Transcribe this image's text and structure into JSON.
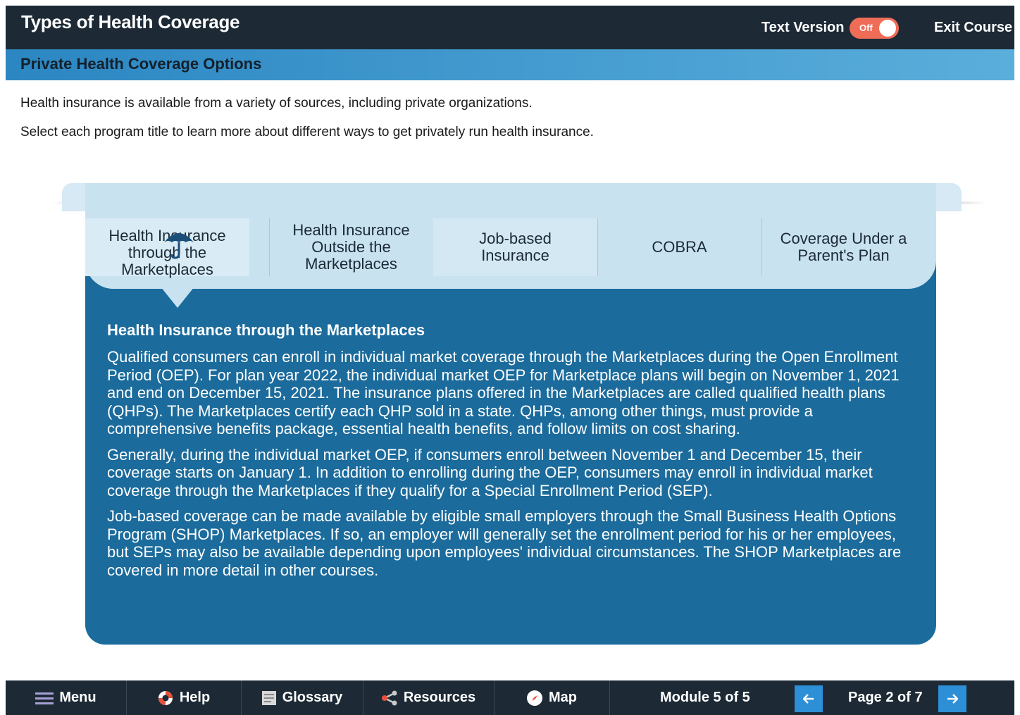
{
  "header": {
    "course_title": "Types of Health Coverage",
    "text_version_label": "Text Version",
    "toggle_state": "Off",
    "exit_label": "Exit Course"
  },
  "section": {
    "title": "Private Health Coverage Options"
  },
  "intro": {
    "line1": "Health insurance is available from a variety of sources, including private organizations.",
    "line2": "Select each program title to learn more about different ways to get privately run health insurance."
  },
  "tabs": [
    {
      "label": "Health Insurance through the Marketplaces",
      "active": true,
      "icon": "umbrella-icon"
    },
    {
      "label": "Health Insurance Outside the Marketplaces",
      "active": false
    },
    {
      "label": "Job-based Insurance",
      "active": false
    },
    {
      "label": "COBRA",
      "active": false
    },
    {
      "label": "Coverage Under a Parent's Plan",
      "active": false
    }
  ],
  "panel": {
    "heading": "Health Insurance through the Marketplaces",
    "paragraphs": [
      "Qualified consumers can enroll in individual market coverage through the Marketplaces during the Open Enrollment Period (OEP). For plan year 2022, the individual market OEP for Marketplace plans will begin on November 1, 2021 and end on December 15, 2021. The insurance plans offered in the Marketplaces are called qualified health plans (QHPs). The Marketplaces certify each QHP sold in a state. QHPs, among other things, must provide a comprehensive benefits package, essential health benefits, and follow limits on cost sharing.",
      "Generally, during the individual market OEP, if consumers enroll between November 1 and December 15, their coverage starts on January 1. In addition to enrolling during the OEP, consumers may enroll in individual market coverage through the Marketplaces if they qualify for a Special Enrollment Period (SEP).",
      "Job-based coverage can be made available by eligible small employers through the Small Business Health Options Program (SHOP) Marketplaces. If so, an employer will generally set the enrollment period for his or her employees, but SEPs may also be available depending upon employees' individual circumstances. The SHOP Marketplaces are covered in more detail in other courses."
    ]
  },
  "footer": {
    "menu": "Menu",
    "help": "Help",
    "glossary": "Glossary",
    "resources": "Resources",
    "map": "Map",
    "module": "Module 5 of 5",
    "page": "Page 2 of 7"
  },
  "colors": {
    "top_bar": "#1d2a36",
    "section_bar": "#2b86c2",
    "panel": "#1b6b9c",
    "toggle": "#ef6c57",
    "nav_arrow": "#2d8fd6"
  }
}
